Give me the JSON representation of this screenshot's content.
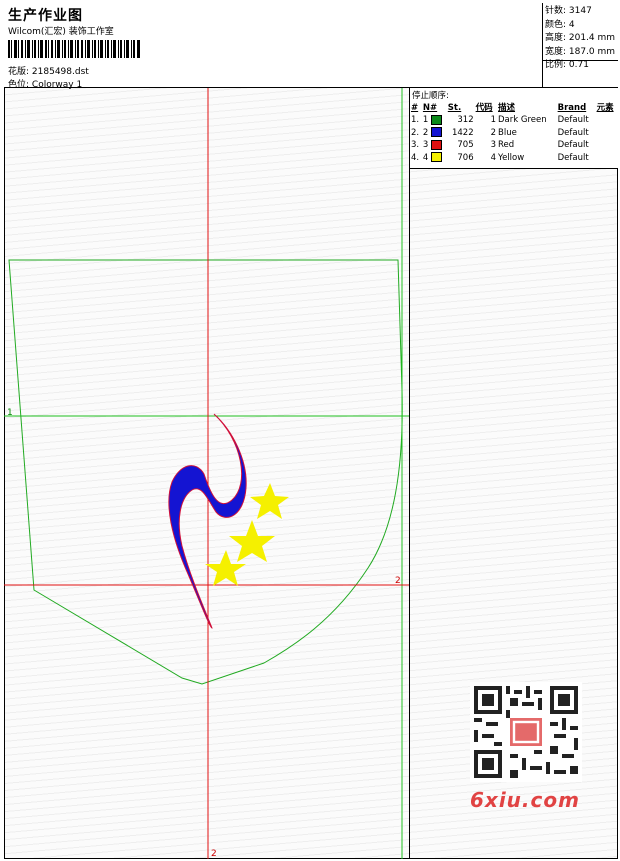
{
  "header": {
    "title": "生产作业图",
    "subtitle": "Wilcom(汇宏) 装饰工作室",
    "design_label": "花版:",
    "design_value": "2185498.dst",
    "colorway_label": "色位:",
    "colorway_value": "Colorway 1"
  },
  "stats": {
    "stitches": "针数: 3147",
    "colors": "颜色: 4",
    "height": "高度: 201.4 mm",
    "width": "宽度: 187.0 mm",
    "ratio": "比例: 0.71"
  },
  "legend": {
    "title": "停止顺序:",
    "columns": [
      "#",
      "N#",
      "St.",
      "代码",
      "描述",
      "Brand",
      "元素"
    ],
    "rows": [
      {
        "idx": "1.",
        "n": "1",
        "color": "#0b8a1a",
        "st": "312",
        "code": "1",
        "desc": "Dark Green",
        "brand": "Default"
      },
      {
        "idx": "2.",
        "n": "2",
        "color": "#1414d2",
        "st": "1422",
        "code": "2",
        "desc": "Blue",
        "brand": "Default"
      },
      {
        "idx": "3.",
        "n": "3",
        "color": "#e01010",
        "st": "705",
        "code": "3",
        "desc": "Red",
        "brand": "Default"
      },
      {
        "idx": "4.",
        "n": "4",
        "color": "#f5f000",
        "st": "706",
        "code": "4",
        "desc": "Yellow",
        "brand": "Default"
      }
    ]
  },
  "markers": {
    "h_green": "1",
    "h_red": "2",
    "v_red": "2"
  },
  "colors": {
    "guide_red": "#e01010",
    "guide_green": "#1fbf1f",
    "outline": "#22aa22",
    "shape_blue": "#1414d2",
    "shape_red": "#d0103a",
    "stars": "#f5f000"
  },
  "watermark": "6xiu.com"
}
